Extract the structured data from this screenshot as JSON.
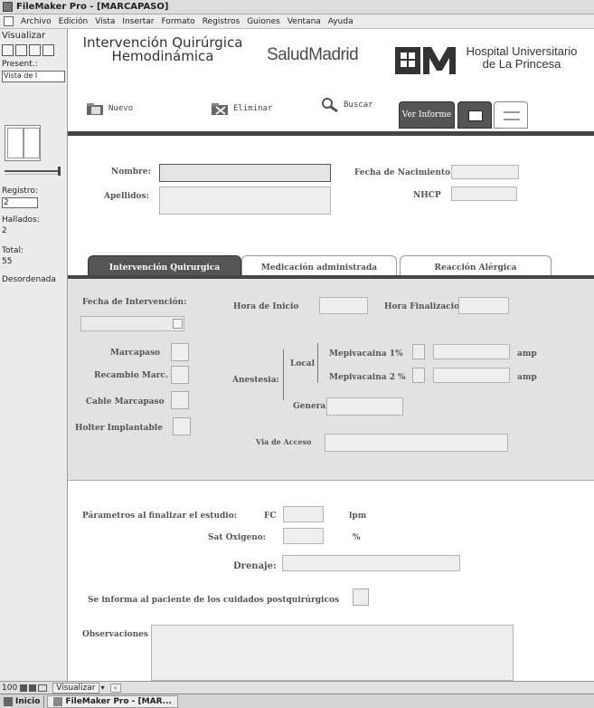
{
  "window": {
    "title": "FileMaker Pro - [MARCAPASO]"
  },
  "menu": [
    "Archivo",
    "Edición",
    "Vista",
    "Insertar",
    "Formato",
    "Registros",
    "Guiones",
    "Ventana",
    "Ayuda"
  ],
  "status": {
    "mode": "Visualizar",
    "present_label": "Present.:",
    "present_value": "Vista de l",
    "record_label": "Registro:",
    "record_value": "2",
    "found_label": "Hallados:",
    "found_value": "2",
    "total_label": "Total:",
    "total_value": "55",
    "sort_label": "Desordenada"
  },
  "header": {
    "title_line1": "Intervención Quirúrgica",
    "title_line2": "Hemodinámica",
    "brand": "SaludMadrid",
    "hospital_line1": "Hospital Universitario",
    "hospital_line2": "de La Princesa"
  },
  "toolbar": {
    "new_label": "Nuevo",
    "delete_label": "Eliminar",
    "search_label": "Buscar",
    "report_label": "Ver Informe"
  },
  "patient": {
    "nombre_label": "Nombre:",
    "nombre_value": "",
    "apellidos_label": "Apellidos:",
    "birth_label": "Fecha de Nacimiento",
    "nhc_label": "NHCP"
  },
  "tabs": [
    "Intervención Quirurgica",
    "Medicación administrada",
    "Reacción Alérgica"
  ],
  "intervention": {
    "date_label": "Fecha de Intervención:",
    "start_label": "Hora de Inicio",
    "end_label": "Hora Finalizacion",
    "marcapaso_label": "Marcapaso",
    "recambio_label": "Recambio Marc.",
    "cable_label": "Cable Marcapaso",
    "holter_label": "Holter Implantable",
    "anestesia_label": "Anestesia:",
    "local_label": "Local",
    "general_label": "General",
    "mepi1_label": "Mepivacaina 1%",
    "mepi2_label": "Mepivacaina 2 %",
    "amp_unit": "amp",
    "via_label": "Via de Acceso"
  },
  "end_params": {
    "label": "Párametros al finalizar el estudio:",
    "fc_label": "FC",
    "fc_unit": "lpm",
    "sat_label": "Sat Oxigeno:",
    "sat_unit": "%",
    "drenaje_label": "Drenaje:",
    "info_label": "Se informa al paciente de los cuidados postquirúrgicos",
    "obs_label": "Observaciones"
  },
  "bottom": {
    "zoom": "100",
    "mode": "Visualizar"
  },
  "taskbar": {
    "start": "Inicio",
    "task": "FileMaker Pro - [MAR..."
  }
}
